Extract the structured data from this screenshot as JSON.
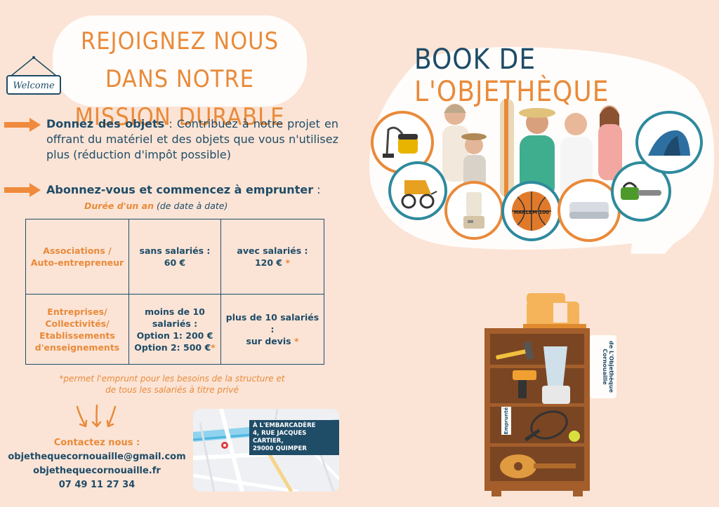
{
  "header": {
    "title_line1": "REJOIGNEZ NOUS DANS NOTRE",
    "title_line2": "MISSION DURABLE",
    "welcome_sign": "Welcome"
  },
  "donnez": {
    "heading": "Donnez des objets",
    "text": " : Contribuez à notre projet en offrant du matériel et des objets que vous n'utilisez plus (réduction d'impôt possible)"
  },
  "abonnez": {
    "heading": "Abonnez-vous et commencez à emprunter",
    "suffix": " :",
    "duree_bold": "Durée d'un an",
    "duree_rest": " (de date à date)"
  },
  "pricing": {
    "row1": {
      "category": "Associations / Auto-entrepreneur",
      "col2_line1": "sans salariés :",
      "col2_line2": "60 €",
      "col3_line1": "avec salariés :",
      "col3_line2": "120 €",
      "col3_star": " *"
    },
    "row2": {
      "category_l1": "Entreprises/",
      "category_l2": "Collectivités/",
      "category_l3": "Etablissements",
      "category_l4": "d'enseignements",
      "col2_line1": "moins de 10",
      "col2_line2": "salariés :",
      "col2_line3": "Option 1: 200 €",
      "col2_line4": "Option 2: 500 €",
      "col2_star": "*",
      "col3_line1": "plus de 10 salariés :",
      "col3_line2": "sur devis",
      "col3_star": " *"
    }
  },
  "note": {
    "line1": "*permet l'emprunt pour les besoins de la structure et",
    "line2": "de tous les salariés à titre privé"
  },
  "contact": {
    "label": "Contactez nous :",
    "email": "objethequecornouaille@gmail.com",
    "website": "objethequecornouaille.fr",
    "phone": "07 49 11 27 34"
  },
  "map": {
    "line1": "À L'EMBARCADÈRE",
    "line2": "4, RUE JACQUES CARTIER,",
    "line3": "29000 QUIMPER"
  },
  "book": {
    "title_a": "BOOK DE ",
    "title_b": "L'OBJETHÈQUE"
  },
  "shelf": {
    "sign_line1": "de",
    "sign_line2": "L'Objethèque",
    "sign_line3": "Cornouaille",
    "tag": "Emprunté",
    "ball_text": "HARLEM 100"
  },
  "colors": {
    "orange": "#e98a3a",
    "navy": "#1f4c67",
    "background": "#fbe4d6",
    "teal": "#2e8a9c"
  }
}
